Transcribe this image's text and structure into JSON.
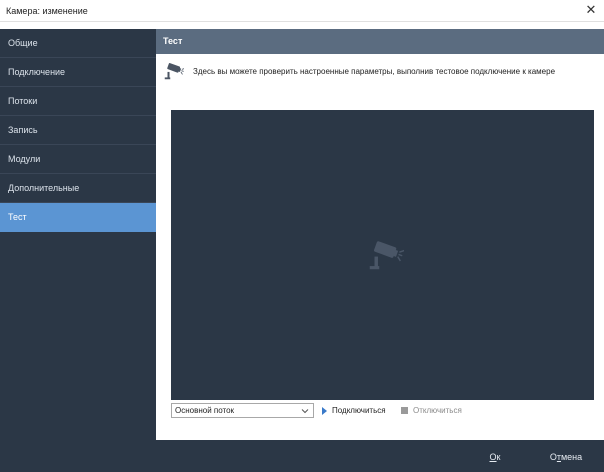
{
  "window": {
    "title": "Камера: изменение",
    "close_glyph": "✕"
  },
  "sidebar": {
    "items": [
      {
        "label": "Общие"
      },
      {
        "label": "Подключение"
      },
      {
        "label": "Потоки"
      },
      {
        "label": "Запись"
      },
      {
        "label": "Модули"
      },
      {
        "label": "Дополнительные"
      },
      {
        "label": "Тест",
        "active": true
      }
    ]
  },
  "panel": {
    "title": "Тест",
    "info_text": "Здесь вы можете проверить настроенные параметры, выполнив тестовое подключение к камере",
    "info_icon": "camera-icon"
  },
  "video": {
    "placeholder_icon": "camera-icon"
  },
  "controls": {
    "stream_select": {
      "value": "Основной поток"
    },
    "connect_label": "Подключиться",
    "disconnect_label": "Отключиться"
  },
  "footer": {
    "ok_underlined": "О",
    "ok_rest": "к",
    "cancel_first": "О",
    "cancel_underlined": "т",
    "cancel_rest": "мена"
  },
  "colors": {
    "sidebar_bg": "#2b3746",
    "active_item": "#5b95d3",
    "panel_header": "#5b6c80",
    "video_bg": "#2b3746",
    "connect_accent": "#3a7ac9"
  }
}
